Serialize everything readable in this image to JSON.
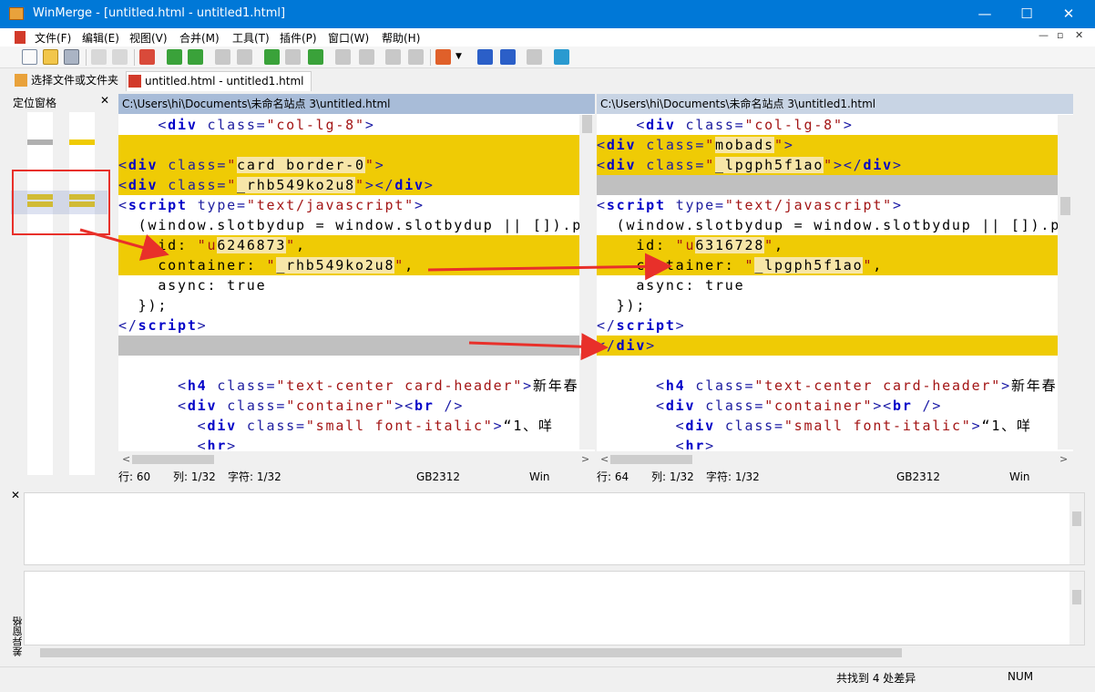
{
  "window": {
    "title": "WinMerge - [untitled.html - untitled1.html]",
    "minimize": "—",
    "maximize": "☐",
    "close": "✕"
  },
  "menu": {
    "items": [
      "文件(F)",
      "编辑(E)",
      "视图(V)",
      "合并(M)",
      "工具(T)",
      "插件(P)",
      "窗口(W)",
      "帮助(H)"
    ],
    "mdi_min": "—",
    "mdi_restore": "▫",
    "mdi_close": "✕"
  },
  "toolbar": {
    "icons": [
      "new-icon",
      "open-icon",
      "save-icon",
      "undo-icon",
      "redo-icon",
      "merge-icon",
      "first-diff-icon",
      "next-diff-icon",
      "prev-diff-icon",
      "last-diff-icon",
      "current-diff-icon",
      "copy-right-icon",
      "copy-left-icon",
      "copy-all-right-icon",
      "copy-all-left-icon",
      "options-icon",
      "compare-icon",
      "refresh-icon"
    ]
  },
  "tabs": [
    {
      "label": "选择文件或文件夹",
      "active": false
    },
    {
      "label": "untitled.html - untitled1.html",
      "active": true
    }
  ],
  "location_pane": {
    "title": "定位窗格",
    "close": "✕"
  },
  "left_pane": {
    "path": "C:\\Users\\hi\\Documents\\未命名站点 3\\untitled.html",
    "status": {
      "line": "行: 60",
      "col": "列: 1/32",
      "char": "字符: 1/32",
      "encoding": "GB2312",
      "eol": "Win"
    },
    "lines": [
      {
        "kind": "normal",
        "segs": [
          [
            "txt",
            "    "
          ],
          [
            "br",
            "<"
          ],
          [
            "tag",
            "div"
          ],
          [
            "txt",
            " "
          ],
          [
            "att",
            "class"
          ],
          [
            "br",
            "="
          ],
          [
            "str",
            "\"col-lg-8\""
          ],
          [
            "br",
            ">"
          ]
        ]
      },
      {
        "kind": "diff",
        "segs": []
      },
      {
        "kind": "diff",
        "segs": [
          [
            "br",
            "<"
          ],
          [
            "tag",
            "div"
          ],
          [
            "txt",
            " "
          ],
          [
            "att",
            "class"
          ],
          [
            "br",
            "="
          ],
          [
            "str",
            "\""
          ],
          [
            "hl",
            "card border-0"
          ],
          [
            "str",
            "\""
          ],
          [
            "br",
            ">"
          ]
        ]
      },
      {
        "kind": "diff",
        "segs": [
          [
            "br",
            "<"
          ],
          [
            "tag",
            "div"
          ],
          [
            "txt",
            " "
          ],
          [
            "att",
            "class"
          ],
          [
            "br",
            "="
          ],
          [
            "str",
            "\""
          ],
          [
            "hl",
            "_rhb549ko2u8"
          ],
          [
            "str",
            "\""
          ],
          [
            "br",
            "></"
          ],
          [
            "tag",
            "div"
          ],
          [
            "br",
            ">"
          ]
        ]
      },
      {
        "kind": "normal",
        "segs": [
          [
            "br",
            "<"
          ],
          [
            "tag",
            "script"
          ],
          [
            "txt",
            " "
          ],
          [
            "att",
            "type"
          ],
          [
            "br",
            "="
          ],
          [
            "str",
            "\"text/javascript\""
          ],
          [
            "br",
            ">"
          ]
        ]
      },
      {
        "kind": "normal",
        "segs": [
          [
            "txt",
            "  (window.slotbydup = window.slotbydup || []).push"
          ]
        ]
      },
      {
        "kind": "diff",
        "segs": [
          [
            "txt",
            "    id: "
          ],
          [
            "str",
            "\"u"
          ],
          [
            "hl",
            "6246873"
          ],
          [
            "str",
            "\""
          ],
          [
            "txt",
            ","
          ]
        ]
      },
      {
        "kind": "diff",
        "segs": [
          [
            "txt",
            "    container: "
          ],
          [
            "str",
            "\""
          ],
          [
            "hl",
            "_rhb549ko2u8"
          ],
          [
            "str",
            "\""
          ],
          [
            "txt",
            ","
          ]
        ]
      },
      {
        "kind": "normal",
        "segs": [
          [
            "txt",
            "    async: true"
          ]
        ]
      },
      {
        "kind": "normal",
        "segs": [
          [
            "txt",
            "  });"
          ]
        ]
      },
      {
        "kind": "normal",
        "segs": [
          [
            "br",
            "</"
          ],
          [
            "tag",
            "script"
          ],
          [
            "br",
            ">"
          ]
        ]
      },
      {
        "kind": "gap",
        "segs": []
      },
      {
        "kind": "normal",
        "segs": []
      },
      {
        "kind": "normal",
        "segs": [
          [
            "txt",
            "      "
          ],
          [
            "br",
            "<"
          ],
          [
            "tag",
            "h4"
          ],
          [
            "txt",
            " "
          ],
          [
            "att",
            "class"
          ],
          [
            "br",
            "="
          ],
          [
            "str",
            "\"text-center card-header\""
          ],
          [
            "br",
            ">"
          ],
          [
            "txt",
            "新年春"
          ]
        ]
      },
      {
        "kind": "normal",
        "segs": [
          [
            "txt",
            "      "
          ],
          [
            "br",
            "<"
          ],
          [
            "tag",
            "div"
          ],
          [
            "txt",
            " "
          ],
          [
            "att",
            "class"
          ],
          [
            "br",
            "="
          ],
          [
            "str",
            "\"container\""
          ],
          [
            "br",
            "><"
          ],
          [
            "tag",
            "br"
          ],
          [
            "txt",
            " "
          ],
          [
            "br",
            "/>"
          ]
        ]
      },
      {
        "kind": "normal",
        "segs": [
          [
            "txt",
            "        "
          ],
          [
            "br",
            "<"
          ],
          [
            "tag",
            "div"
          ],
          [
            "txt",
            " "
          ],
          [
            "att",
            "class"
          ],
          [
            "br",
            "="
          ],
          [
            "str",
            "\"small font-italic\""
          ],
          [
            "br",
            ">"
          ],
          [
            "txt",
            "“1、咩"
          ]
        ]
      },
      {
        "kind": "normal",
        "segs": [
          [
            "txt",
            "        "
          ],
          [
            "br",
            "<"
          ],
          [
            "tag",
            "hr"
          ],
          [
            "br",
            ">"
          ]
        ]
      }
    ]
  },
  "right_pane": {
    "path": "C:\\Users\\hi\\Documents\\未命名站点 3\\untitled1.html",
    "status": {
      "line": "行: 64",
      "col": "列: 1/32",
      "char": "字符: 1/32",
      "encoding": "GB2312",
      "eol": "Win"
    },
    "lines": [
      {
        "kind": "normal",
        "segs": [
          [
            "txt",
            "    "
          ],
          [
            "br",
            "<"
          ],
          [
            "tag",
            "div"
          ],
          [
            "txt",
            " "
          ],
          [
            "att",
            "class"
          ],
          [
            "br",
            "="
          ],
          [
            "str",
            "\"col-lg-8\""
          ],
          [
            "br",
            ">"
          ]
        ]
      },
      {
        "kind": "diff",
        "segs": [
          [
            "br",
            "<"
          ],
          [
            "tag",
            "div"
          ],
          [
            "txt",
            " "
          ],
          [
            "att",
            "class"
          ],
          [
            "br",
            "="
          ],
          [
            "str",
            "\""
          ],
          [
            "hl",
            "mobads"
          ],
          [
            "str",
            "\""
          ],
          [
            "br",
            ">"
          ]
        ]
      },
      {
        "kind": "diff",
        "segs": [
          [
            "br",
            "<"
          ],
          [
            "tag",
            "div"
          ],
          [
            "txt",
            " "
          ],
          [
            "att",
            "class"
          ],
          [
            "br",
            "="
          ],
          [
            "str",
            "\""
          ],
          [
            "hl",
            "_lpgph5f1ao"
          ],
          [
            "str",
            "\""
          ],
          [
            "br",
            "></"
          ],
          [
            "tag",
            "div"
          ],
          [
            "br",
            ">"
          ]
        ]
      },
      {
        "kind": "gap",
        "segs": []
      },
      {
        "kind": "normal",
        "segs": [
          [
            "br",
            "<"
          ],
          [
            "tag",
            "script"
          ],
          [
            "txt",
            " "
          ],
          [
            "att",
            "type"
          ],
          [
            "br",
            "="
          ],
          [
            "str",
            "\"text/javascript\""
          ],
          [
            "br",
            ">"
          ]
        ]
      },
      {
        "kind": "normal",
        "segs": [
          [
            "txt",
            "  (window.slotbydup = window.slotbydup || []).push"
          ]
        ]
      },
      {
        "kind": "diff",
        "segs": [
          [
            "txt",
            "    id: "
          ],
          [
            "str",
            "\"u"
          ],
          [
            "hl",
            "6316728"
          ],
          [
            "str",
            "\""
          ],
          [
            "txt",
            ","
          ]
        ]
      },
      {
        "kind": "diff",
        "segs": [
          [
            "txt",
            "    container: "
          ],
          [
            "str",
            "\""
          ],
          [
            "hl",
            "_lpgph5f1ao"
          ],
          [
            "str",
            "\""
          ],
          [
            "txt",
            ","
          ]
        ]
      },
      {
        "kind": "normal",
        "segs": [
          [
            "txt",
            "    async: true"
          ]
        ]
      },
      {
        "kind": "normal",
        "segs": [
          [
            "txt",
            "  });"
          ]
        ]
      },
      {
        "kind": "normal",
        "segs": [
          [
            "br",
            "</"
          ],
          [
            "tag",
            "script"
          ],
          [
            "br",
            ">"
          ]
        ]
      },
      {
        "kind": "diff",
        "segs": [
          [
            "br",
            "</"
          ],
          [
            "tag",
            "div"
          ],
          [
            "br",
            ">"
          ]
        ]
      },
      {
        "kind": "normal",
        "segs": []
      },
      {
        "kind": "normal",
        "segs": [
          [
            "txt",
            "      "
          ],
          [
            "br",
            "<"
          ],
          [
            "tag",
            "h4"
          ],
          [
            "txt",
            " "
          ],
          [
            "att",
            "class"
          ],
          [
            "br",
            "="
          ],
          [
            "str",
            "\"text-center card-header\""
          ],
          [
            "br",
            ">"
          ],
          [
            "txt",
            "新年春"
          ]
        ]
      },
      {
        "kind": "normal",
        "segs": [
          [
            "txt",
            "      "
          ],
          [
            "br",
            "<"
          ],
          [
            "tag",
            "div"
          ],
          [
            "txt",
            " "
          ],
          [
            "att",
            "class"
          ],
          [
            "br",
            "="
          ],
          [
            "str",
            "\"container\""
          ],
          [
            "br",
            "><"
          ],
          [
            "tag",
            "br"
          ],
          [
            "txt",
            " "
          ],
          [
            "br",
            "/>"
          ]
        ]
      },
      {
        "kind": "normal",
        "segs": [
          [
            "txt",
            "        "
          ],
          [
            "br",
            "<"
          ],
          [
            "tag",
            "div"
          ],
          [
            "txt",
            " "
          ],
          [
            "att",
            "class"
          ],
          [
            "br",
            "="
          ],
          [
            "str",
            "\"small font-italic\""
          ],
          [
            "br",
            ">"
          ],
          [
            "txt",
            "“1、咩"
          ]
        ]
      },
      {
        "kind": "normal",
        "segs": [
          [
            "txt",
            "        "
          ],
          [
            "br",
            "<"
          ],
          [
            "tag",
            "hr"
          ],
          [
            "br",
            ">"
          ]
        ]
      }
    ]
  },
  "diff_pane": {
    "close": "✕",
    "title": "差异窗格"
  },
  "statusbar": {
    "summary": "共找到 4 处差异",
    "num": "NUM"
  },
  "colors": {
    "diff": "#efcb05",
    "gap": "#c0c0c0",
    "titlebar": "#0078d7",
    "annotation": "#e8302a"
  }
}
